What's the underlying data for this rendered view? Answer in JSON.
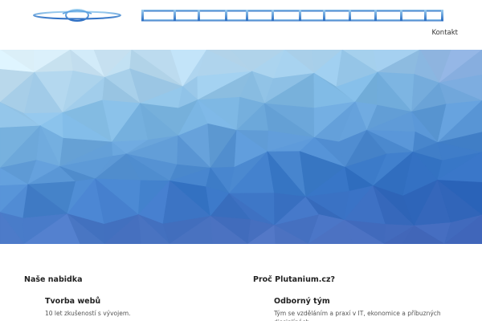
{
  "site": {
    "logo_name": "plutanium-logo",
    "accent": "#3a7bd5"
  },
  "nav": {
    "items": [
      {
        "label": "Kontakt"
      }
    ]
  },
  "hero": {
    "colors": [
      "#e9f7fc",
      "#7fb9e3",
      "#3a79c9",
      "#2555b0",
      "#8a8fd0"
    ]
  },
  "offer": {
    "title": "Naše nabidka",
    "items": [
      {
        "title": "Tvorba webů",
        "desc": "10 let zkušeností s vývojem."
      }
    ]
  },
  "why": {
    "title": "Proč Plutanium.cz?",
    "items": [
      {
        "title": "Odborný tým",
        "desc": "Tým se vzděláním a praxí v IT, ekonomice a příbuzných disciplínách."
      }
    ]
  }
}
